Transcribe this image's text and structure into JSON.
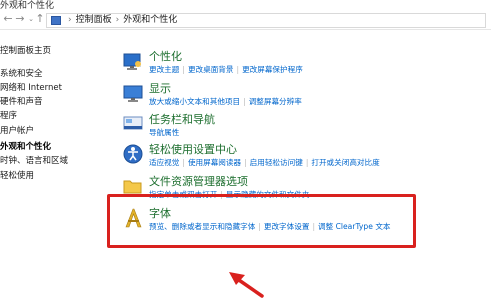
{
  "window": {
    "title": "外观和个性化"
  },
  "address": {
    "crumbs": [
      "控制面板",
      "外观和个性化"
    ]
  },
  "sidebar": {
    "items": [
      {
        "label": "控制面板主页"
      },
      {
        "label": "系统和安全"
      },
      {
        "label": "网络和 Internet"
      },
      {
        "label": "硬件和声音"
      },
      {
        "label": "程序"
      },
      {
        "label": "用户帐户"
      },
      {
        "label": "外观和个性化"
      },
      {
        "label": "时钟、语言和区域"
      },
      {
        "label": "轻松使用"
      }
    ]
  },
  "categories": [
    {
      "title": "个性化",
      "links": [
        "更改主题",
        "更改桌面背景",
        "更改屏幕保护程序"
      ]
    },
    {
      "title": "显示",
      "links": [
        "放大或缩小文本和其他项目",
        "调整屏幕分辨率"
      ]
    },
    {
      "title": "任务栏和导航",
      "links": [
        "导航属性"
      ]
    },
    {
      "title": "轻松使用设置中心",
      "links": [
        "适应视觉",
        "使用屏幕阅读器",
        "启用轻松访问键",
        "打开或关闭高对比度"
      ]
    },
    {
      "title": "文件资源管理器选项",
      "links": [
        "指定单击或双击打开",
        "显示隐藏的文件和文件夹"
      ]
    },
    {
      "title": "字体",
      "links": [
        "预览、删除或者显示和隐藏字体",
        "更改字体设置",
        "调整 ClearType 文本"
      ]
    }
  ],
  "colors": {
    "highlight": "#d9211e",
    "link": "#0066cc",
    "category_title": "#1c6e2e"
  }
}
